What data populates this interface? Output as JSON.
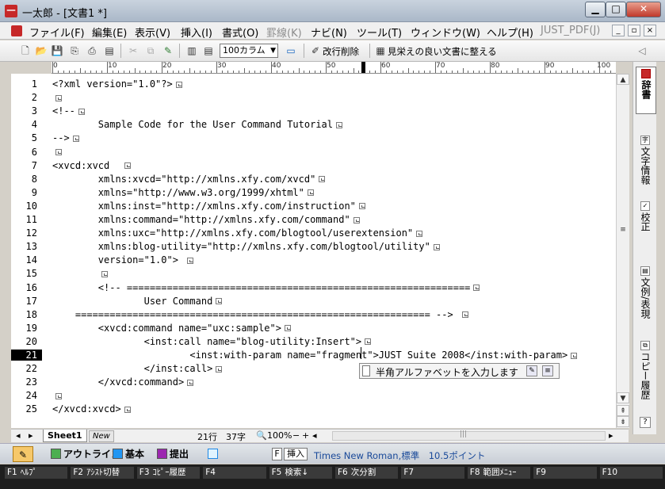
{
  "window": {
    "title": "一太郎 - [文書1 *]",
    "controls": [
      "▁",
      "□",
      "✕"
    ]
  },
  "menu": {
    "items": [
      {
        "label": "ファイル(F)",
        "enabled": true
      },
      {
        "label": "編集(E)",
        "enabled": true
      },
      {
        "label": "表示(V)",
        "enabled": true
      },
      {
        "label": "挿入(I)",
        "enabled": true
      },
      {
        "label": "書式(O)",
        "enabled": true
      },
      {
        "label": "罫線(K)",
        "enabled": false
      },
      {
        "label": "ナビ(N)",
        "enabled": true
      },
      {
        "label": "ツール(T)",
        "enabled": true
      },
      {
        "label": "ウィンドウ(W)",
        "enabled": true
      },
      {
        "label": "ヘルプ(H)",
        "enabled": true
      },
      {
        "label": "JUST_PDF(J)",
        "enabled": false
      }
    ],
    "mdi_controls": [
      "_",
      "▫",
      "×"
    ]
  },
  "toolbar": {
    "columns_value": "100カラム",
    "delete_breaks_label": "改行削除",
    "tidy_label": "見栄えの良い文書に整える",
    "icons": [
      "new-document-icon",
      "open-folder-icon",
      "save-icon",
      "save-as-icon",
      "print-icon",
      "print-preview-icon",
      "cut-icon",
      "copy-icon",
      "paste-icon",
      "column-view-icon",
      "page-view-icon",
      "frame-icon",
      "delete-breaks-icon",
      "tidy-document-icon"
    ]
  },
  "ruler": {
    "labels": [
      "0",
      "10",
      "20",
      "30",
      "40",
      "50",
      "60",
      "70",
      "80",
      "90",
      "100"
    ]
  },
  "editor": {
    "current_line": 21,
    "lines": [
      {
        "n": "1",
        "text": "<?xml version=\"1.0\"?>"
      },
      {
        "n": "2",
        "text": ""
      },
      {
        "n": "3",
        "text": "<!--"
      },
      {
        "n": "4",
        "text": "        Sample Code for the User Command Tutorial"
      },
      {
        "n": "5",
        "text": "-->"
      },
      {
        "n": "6",
        "text": ""
      },
      {
        "n": "7",
        "text": "<xvcd:xvcd  "
      },
      {
        "n": "8",
        "text": "        xmlns:xvcd=\"http://xmlns.xfy.com/xvcd\""
      },
      {
        "n": "9",
        "text": "        xmlns=\"http://www.w3.org/1999/xhtml\""
      },
      {
        "n": "10",
        "text": "        xmlns:inst=\"http://xmlns.xfy.com/instruction\""
      },
      {
        "n": "11",
        "text": "        xmlns:command=\"http://xmlns.xfy.com/command\""
      },
      {
        "n": "12",
        "text": "        xmlns:uxc=\"http://xmlns.xfy.com/blogtool/userextension\""
      },
      {
        "n": "13",
        "text": "        xmlns:blog-utility=\"http://xmlns.xfy.com/blogtool/utility\""
      },
      {
        "n": "14",
        "text": "        version=\"1.0\"> "
      },
      {
        "n": "15",
        "text": "        "
      },
      {
        "n": "16",
        "text": "        <!-- ============================================================"
      },
      {
        "n": "17",
        "text": "                User Command"
      },
      {
        "n": "18",
        "text": "    ============================================================== --> "
      },
      {
        "n": "19",
        "text": "        <xvcd:command name=\"uxc:sample\">"
      },
      {
        "n": "20",
        "text": "                <inst:call name=\"blog-utility:Insert\">"
      },
      {
        "n": "21",
        "text": "                        <inst:with-param name=\"fragment\">JUST Suite 2008</inst:with-param>"
      },
      {
        "n": "22",
        "text": "                </inst:call>"
      },
      {
        "n": "23",
        "text": "        </xvcd:command>"
      },
      {
        "n": "24",
        "text": ""
      },
      {
        "n": "25",
        "text": "</xvcd:xvcd>"
      }
    ]
  },
  "ime_popup": {
    "text": "半角アルファベットを入力します"
  },
  "right_panel": {
    "items": [
      "辞書",
      "文字情報",
      "校正",
      "文例/表現",
      "コピー履歴"
    ],
    "help": "?"
  },
  "sheet_bar": {
    "sheet_tab": "Sheet1",
    "new_tab": "New",
    "row_col": "21行　37字",
    "zoom": "100%"
  },
  "status_bar": {
    "tabs": [
      "アウトライン",
      "基本",
      "提出"
    ],
    "mode_f": "F",
    "mode_insert": "挿入",
    "font_info": "Times New Roman,標準　10.5ポイント"
  },
  "function_keys": [
    {
      "key": "F1",
      "label": "ﾍﾙﾌﾟ"
    },
    {
      "key": "F2",
      "label": "ｱｼｽﾄ切替"
    },
    {
      "key": "F3",
      "label": "ｺﾋﾟｰ履歴"
    },
    {
      "key": "F4",
      "label": ""
    },
    {
      "key": "F5",
      "label": "検索↓"
    },
    {
      "key": "F6",
      "label": "次分割"
    },
    {
      "key": "F7",
      "label": ""
    },
    {
      "key": "F8",
      "label": "範囲ﾒﾆｭｰ"
    },
    {
      "key": "F9",
      "label": ""
    },
    {
      "key": "F10",
      "label": ""
    }
  ],
  "colors": {
    "accent_red": "#c62828",
    "font_info_blue": "#1a4a9a"
  }
}
